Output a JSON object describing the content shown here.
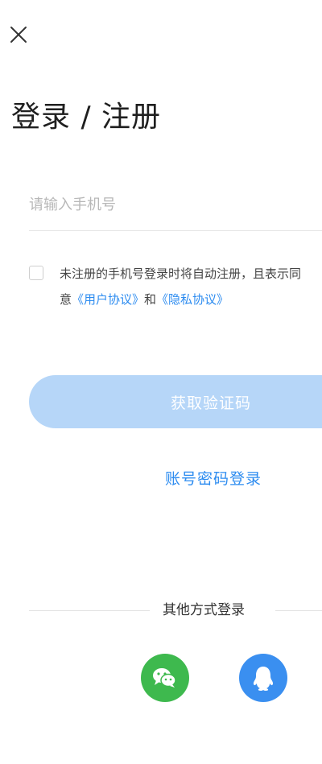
{
  "header": {
    "close_icon": "close-icon",
    "title": "登录 / 注册"
  },
  "form": {
    "phone_placeholder": "请输入手机号",
    "phone_value": ""
  },
  "agreement": {
    "checked": false,
    "text_before": "未注册的手机号登录时将自动注册，且表示同",
    "text_prefix": "意",
    "user_agreement": "《用户协议》",
    "and": "和",
    "privacy_policy": "《隐私协议》"
  },
  "actions": {
    "get_code": "获取验证码",
    "password_login": "账号密码登录"
  },
  "other_login": {
    "label": "其他方式登录",
    "wechat_icon": "wechat-icon",
    "qq_icon": "qq-icon"
  },
  "colors": {
    "accent": "#2d8cf0",
    "primary_disabled": "#b6d6f8",
    "wechat": "#3eb94e",
    "qq": "#3a8ff0"
  }
}
